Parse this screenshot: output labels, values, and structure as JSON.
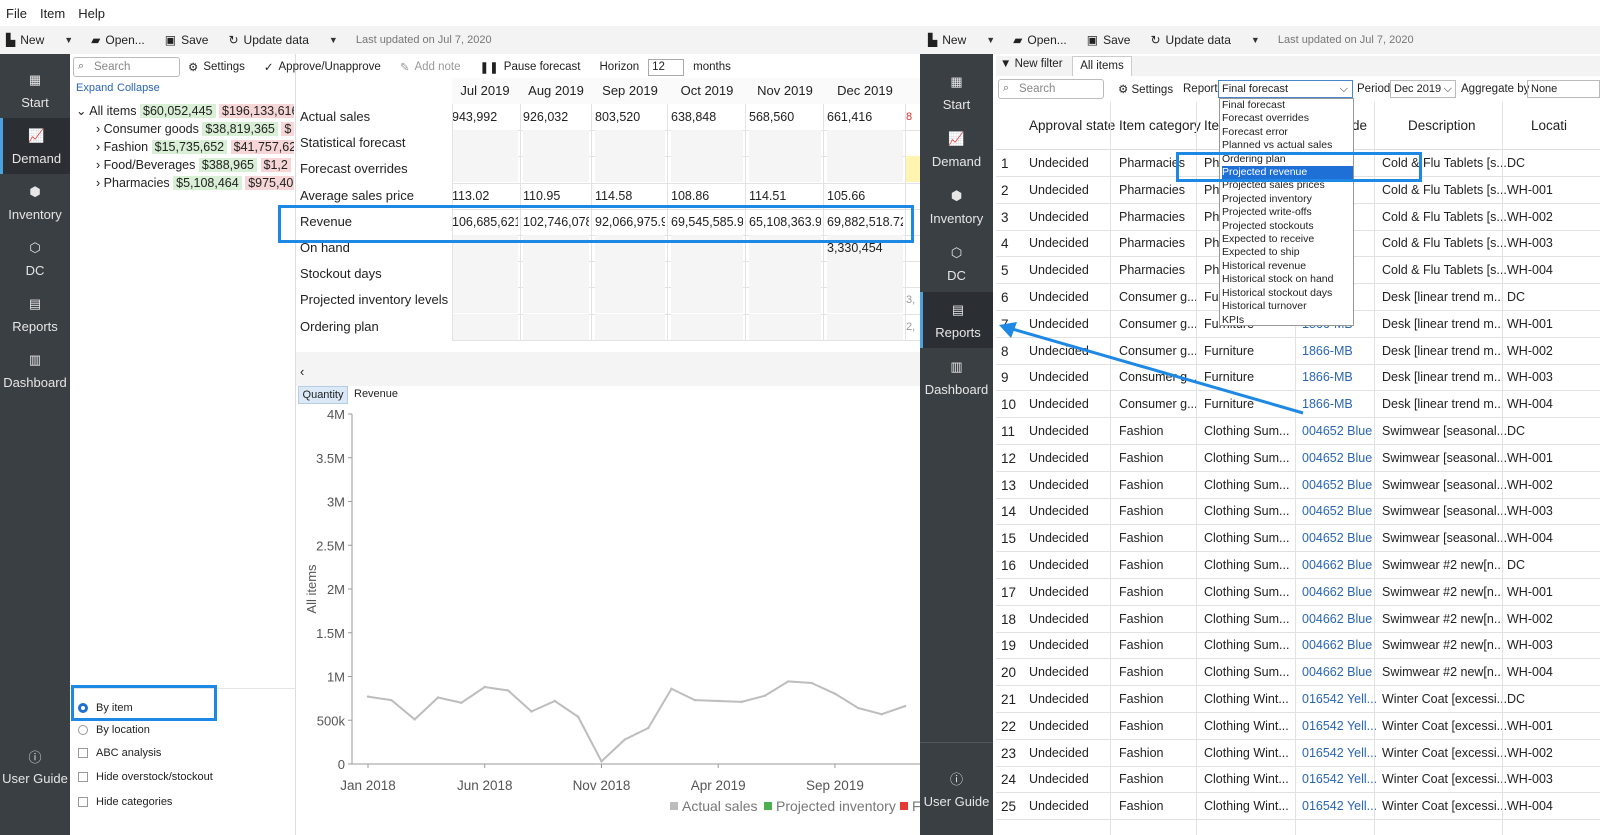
{
  "menu": [
    "File",
    "Item",
    "Help"
  ],
  "toolbar": {
    "new": "New",
    "open": "Open...",
    "save": "Save",
    "update": "Update data",
    "last_updated": "Last updated on Jul 7, 2020"
  },
  "nav": {
    "start": "Start",
    "demand": "Demand",
    "inventory": "Inventory",
    "dc": "DC",
    "reports": "Reports",
    "dashboard": "Dashboard",
    "guide": "User Guide"
  },
  "left": {
    "search_placeholder": "Search",
    "settings": "Settings",
    "approve": "Approve/Unapprove",
    "add_note": "Add note",
    "pause": "Pause forecast",
    "horizon_label": "Horizon",
    "horizon_value": "12",
    "months": "months",
    "expand": "Expand",
    "collapse": "Collapse",
    "tree": [
      {
        "label": "All items",
        "v1": "$60,052,445",
        "v2": "$196,133,616"
      },
      {
        "label": "Consumer goods",
        "v1": "$38,819,365",
        "v2": "$"
      },
      {
        "label": "Fashion",
        "v1": "$15,735,652",
        "v2": "$41,757,62"
      },
      {
        "label": "Food/Beverages",
        "v1": "$388,965",
        "v2": "$1,2"
      },
      {
        "label": "Pharmacies",
        "v1": "$5,108,464",
        "v2": "$975,40"
      }
    ],
    "options": {
      "by_item": "By item",
      "by_location": "By location",
      "abc": "ABC analysis",
      "hide_overstock": "Hide overstock/stockout",
      "hide_categories": "Hide categories"
    }
  },
  "grid": {
    "months": [
      "Jul 2019",
      "Aug 2019",
      "Sep 2019",
      "Oct 2019",
      "Nov 2019",
      "Dec 2019"
    ],
    "rows": [
      {
        "label": "Actual sales",
        "values": [
          "943,992",
          "926,032",
          "803,520",
          "638,848",
          "568,560",
          "661,416"
        ]
      },
      {
        "label": "Statistical forecast",
        "values": [
          "",
          "",
          "",
          "",
          "",
          ""
        ]
      },
      {
        "label": "Forecast overrides",
        "values": [
          "",
          "",
          "",
          "",
          "",
          ""
        ]
      },
      {
        "label": "Average sales price",
        "values": [
          "113.02",
          "110.95",
          "114.58",
          "108.86",
          "114.51",
          "105.66"
        ]
      },
      {
        "label": "Revenue",
        "values": [
          "106,685,621",
          "102,746,078",
          "92,066,975.95",
          "69,545,585.93",
          "65,108,363.94",
          "69,882,518.72"
        ]
      },
      {
        "label": "On hand",
        "values": [
          "",
          "",
          "",
          "",
          "",
          "3,330,454"
        ]
      },
      {
        "label": "Stockout days",
        "values": [
          "",
          "",
          "",
          "",
          "",
          ""
        ]
      },
      {
        "label": "Projected inventory levels",
        "values": [
          "",
          "",
          "",
          "",
          "",
          ""
        ]
      },
      {
        "label": "Ordering plan",
        "values": [
          "",
          "",
          "",
          "",
          "",
          ""
        ]
      }
    ],
    "edge": [
      "8",
      "",
      "",
      "",
      "",
      "",
      "",
      "3,",
      "2,"
    ]
  },
  "chart_tabs": {
    "quantity": "Quantity",
    "revenue": "Revenue"
  },
  "chart_data": {
    "type": "line",
    "ylabel": "All items",
    "yticks": [
      "0",
      "500k",
      "1M",
      "1.5M",
      "2M",
      "2.5M",
      "3M",
      "3.5M",
      "4M"
    ],
    "xticks": [
      "Jan 2018",
      "Jun 2018",
      "Nov 2018",
      "Apr 2019",
      "Sep 2019"
    ],
    "ylim": [
      0,
      4000000
    ],
    "x": [
      "2018-01",
      "2018-02",
      "2018-03",
      "2018-04",
      "2018-05",
      "2018-06",
      "2018-07",
      "2018-08",
      "2018-09",
      "2018-10",
      "2018-11",
      "2018-12",
      "2019-01",
      "2019-02",
      "2019-03",
      "2019-04",
      "2019-05",
      "2019-06",
      "2019-07",
      "2019-08",
      "2019-09",
      "2019-10",
      "2019-11",
      "2019-12"
    ],
    "series": [
      {
        "name": "Actual sales",
        "values": [
          770000,
          730000,
          510000,
          760000,
          700000,
          880000,
          840000,
          600000,
          720000,
          540000,
          30000,
          280000,
          410000,
          860000,
          730000,
          720000,
          710000,
          780000,
          943992,
          926032,
          803520,
          638848,
          568560,
          661416
        ],
        "color": "#bdbdbd"
      }
    ],
    "legend": [
      "Actual sales",
      "Projected inventory",
      "F"
    ],
    "legend_colors": [
      "#bdbdbd",
      "#4caf50",
      "#e53935"
    ]
  },
  "right": {
    "new_filter": "New filter",
    "all_items": "All items",
    "search_placeholder": "Search",
    "settings": "Settings",
    "report_label": "Report",
    "report_value": "Final forecast",
    "period_label": "Period",
    "period_value": "Dec 2019",
    "aggregate_label": "Aggregate by",
    "aggregate_value": "None",
    "headers": [
      "Approval state",
      "Item category",
      "Ite",
      "de",
      "Description",
      "Locati"
    ],
    "dropdown": [
      "Final forecast",
      "Forecast overrides",
      "Forecast error",
      "Planned vs actual sales",
      "Ordering plan",
      "Projected revenue",
      "Projected sales prices",
      "Projected inventory",
      "Projected write-offs",
      "Projected stockouts",
      "Expected to receive",
      "Expected to ship",
      "Historical revenue",
      "Historical stock on hand",
      "Historical stockout days",
      "Historical turnover",
      "KPIs"
    ],
    "rows": [
      [
        "1",
        "Undecided",
        "Pharmacies",
        "Pha",
        "",
        "Cold & Flu Tablets [s...",
        "DC"
      ],
      [
        "2",
        "Undecided",
        "Pharmacies",
        "Pha",
        "",
        "Cold & Flu Tablets [s...",
        "WH-001"
      ],
      [
        "3",
        "Undecided",
        "Pharmacies",
        "Pha",
        "",
        "Cold & Flu Tablets [s...",
        "WH-002"
      ],
      [
        "4",
        "Undecided",
        "Pharmacies",
        "Pha",
        "",
        "Cold & Flu Tablets [s...",
        "WH-003"
      ],
      [
        "5",
        "Undecided",
        "Pharmacies",
        "Pha",
        "",
        "Cold & Flu Tablets [s...",
        "WH-004"
      ],
      [
        "6",
        "Undecided",
        "Consumer g...",
        "Fur",
        "",
        "Desk [linear trend m...",
        "DC"
      ],
      [
        "7",
        "Undecided",
        "Consumer g...",
        "Furniture",
        "1866-MB",
        "Desk [linear trend m...",
        "WH-001"
      ],
      [
        "8",
        "Undecided",
        "Consumer g...",
        "Furniture",
        "1866-MB",
        "Desk [linear trend m...",
        "WH-002"
      ],
      [
        "9",
        "Undecided",
        "Consumer g...",
        "Furniture",
        "1866-MB",
        "Desk [linear trend m...",
        "WH-003"
      ],
      [
        "10",
        "Undecided",
        "Consumer g...",
        "Furniture",
        "1866-MB",
        "Desk [linear trend m...",
        "WH-004"
      ],
      [
        "11",
        "Undecided",
        "Fashion",
        "Clothing Sum...",
        "004652 Blue",
        "Swimwear [seasonal...",
        "DC"
      ],
      [
        "12",
        "Undecided",
        "Fashion",
        "Clothing Sum...",
        "004652 Blue",
        "Swimwear [seasonal...",
        "WH-001"
      ],
      [
        "13",
        "Undecided",
        "Fashion",
        "Clothing Sum...",
        "004652 Blue",
        "Swimwear [seasonal...",
        "WH-002"
      ],
      [
        "14",
        "Undecided",
        "Fashion",
        "Clothing Sum...",
        "004652 Blue",
        "Swimwear [seasonal...",
        "WH-003"
      ],
      [
        "15",
        "Undecided",
        "Fashion",
        "Clothing Sum...",
        "004652 Blue",
        "Swimwear [seasonal...",
        "WH-004"
      ],
      [
        "16",
        "Undecided",
        "Fashion",
        "Clothing Sum...",
        "004662 Blue",
        "Swimwear #2 new[n...",
        "DC"
      ],
      [
        "17",
        "Undecided",
        "Fashion",
        "Clothing Sum...",
        "004662 Blue",
        "Swimwear #2 new[n...",
        "WH-001"
      ],
      [
        "18",
        "Undecided",
        "Fashion",
        "Clothing Sum...",
        "004662 Blue",
        "Swimwear #2 new[n...",
        "WH-002"
      ],
      [
        "19",
        "Undecided",
        "Fashion",
        "Clothing Sum...",
        "004662 Blue",
        "Swimwear #2 new[n...",
        "WH-003"
      ],
      [
        "20",
        "Undecided",
        "Fashion",
        "Clothing Sum...",
        "004662 Blue",
        "Swimwear #2 new[n...",
        "WH-004"
      ],
      [
        "21",
        "Undecided",
        "Fashion",
        "Clothing Wint...",
        "016542 Yell...",
        "Winter Coat [excessi...",
        "DC"
      ],
      [
        "22",
        "Undecided",
        "Fashion",
        "Clothing Wint...",
        "016542 Yell...",
        "Winter Coat [excessi...",
        "WH-001"
      ],
      [
        "23",
        "Undecided",
        "Fashion",
        "Clothing Wint...",
        "016542 Yell...",
        "Winter Coat [excessi...",
        "WH-002"
      ],
      [
        "24",
        "Undecided",
        "Fashion",
        "Clothing Wint...",
        "016542 Yell...",
        "Winter Coat [excessi...",
        "WH-003"
      ],
      [
        "25",
        "Undecided",
        "Fashion",
        "Clothing Wint...",
        "016542 Yell...",
        "Winter Coat [excessi...",
        "WH-004"
      ]
    ]
  }
}
